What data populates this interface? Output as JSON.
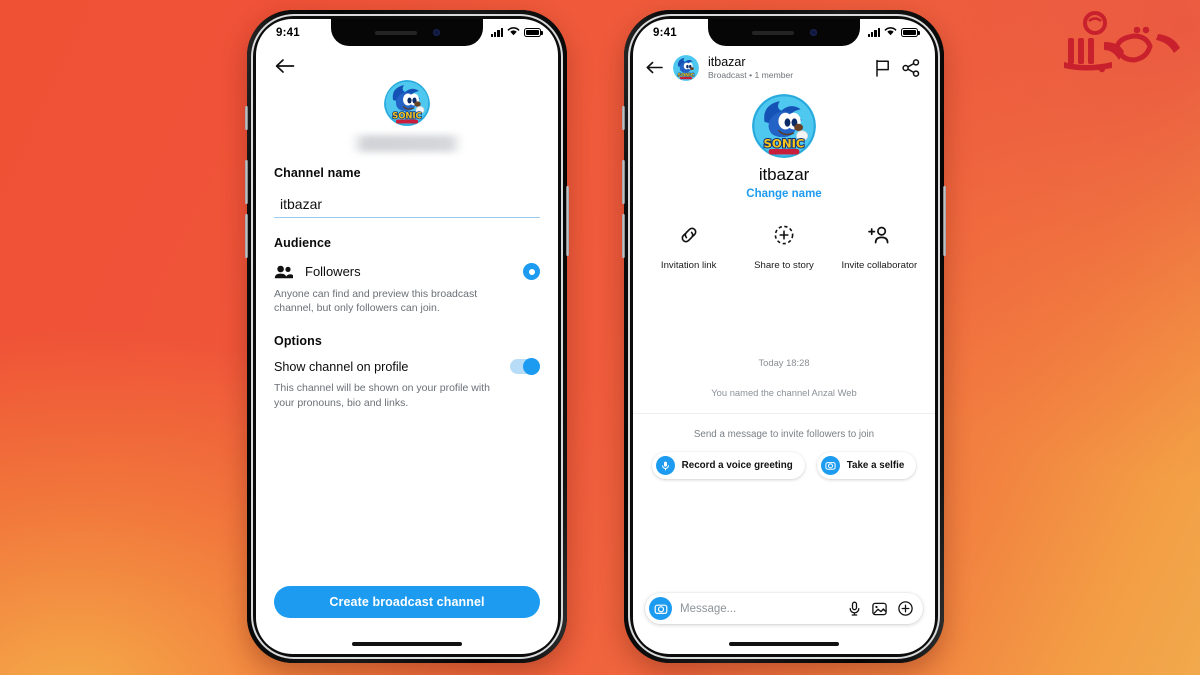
{
  "background": {
    "color_top_left": "#ef5134",
    "color_bottom_left": "#f2a94c",
    "color_top_right": "#e43a42",
    "accent": "#1d9bf0"
  },
  "watermark": {
    "name": "itbazar-logo-watermark",
    "text_fa": "آی‌تی بازار",
    "color": "#c8202c"
  },
  "left_phone": {
    "name": "create-broadcast-channel-screen",
    "status_bar": {
      "time": "9:41",
      "signal": "signal-bars-icon",
      "wifi": "wifi-icon",
      "battery": "battery-full-icon"
    },
    "back_button": "back-arrow-icon",
    "avatar": {
      "name": "sonic-avatar",
      "alt": "Sonic the Hedgehog avatar"
    },
    "blurred_name": "",
    "channel_name_label": "Channel name",
    "channel_name_value": "itbazar",
    "channel_name_placeholder": "Channel name",
    "audience_label": "Audience",
    "audience_option": {
      "icon": "people-icon",
      "label": "Followers",
      "selected": true,
      "description": "Anyone can find and preview this broadcast channel, but only followers can join."
    },
    "options_label": "Options",
    "toggle_option": {
      "label": "Show channel on profile",
      "enabled": true,
      "description": "This channel will be shown on your profile with your pronouns, bio and links."
    },
    "cta_label": "Create broadcast channel"
  },
  "right_phone": {
    "name": "broadcast-channel-detail-screen",
    "status_bar": {
      "time": "9:41",
      "signal": "signal-bars-icon",
      "wifi": "wifi-icon",
      "battery": "battery-full-icon"
    },
    "header": {
      "back_button": "back-arrow-icon",
      "avatar": "sonic-avatar",
      "title": "itbazar",
      "subtitle": "Broadcast • 1 member",
      "flag_button": "flag-icon",
      "share_button": "share-icon"
    },
    "profile": {
      "avatar": "sonic-avatar-large",
      "name": "itbazar",
      "change_name_link": "Change name"
    },
    "actions": [
      {
        "icon": "link-icon",
        "label": "Invitation link"
      },
      {
        "icon": "add-to-story-icon",
        "label": "Share to story"
      },
      {
        "icon": "add-person-icon",
        "label": "Invite collaborator"
      }
    ],
    "timeline": {
      "timestamp": "Today 18:28",
      "system_message": "You named the channel Anzal Web",
      "invite_hint": "Send a message to invite followers to join"
    },
    "chips": [
      {
        "icon": "microphone-icon",
        "label": "Record a voice greeting"
      },
      {
        "icon": "camera-icon",
        "label": "Take a selfie"
      }
    ],
    "composer": {
      "camera_button": "camera-icon",
      "placeholder": "Message...",
      "mic_button": "microphone-icon",
      "gallery_button": "image-icon",
      "plus_button": "plus-circle-icon"
    }
  }
}
